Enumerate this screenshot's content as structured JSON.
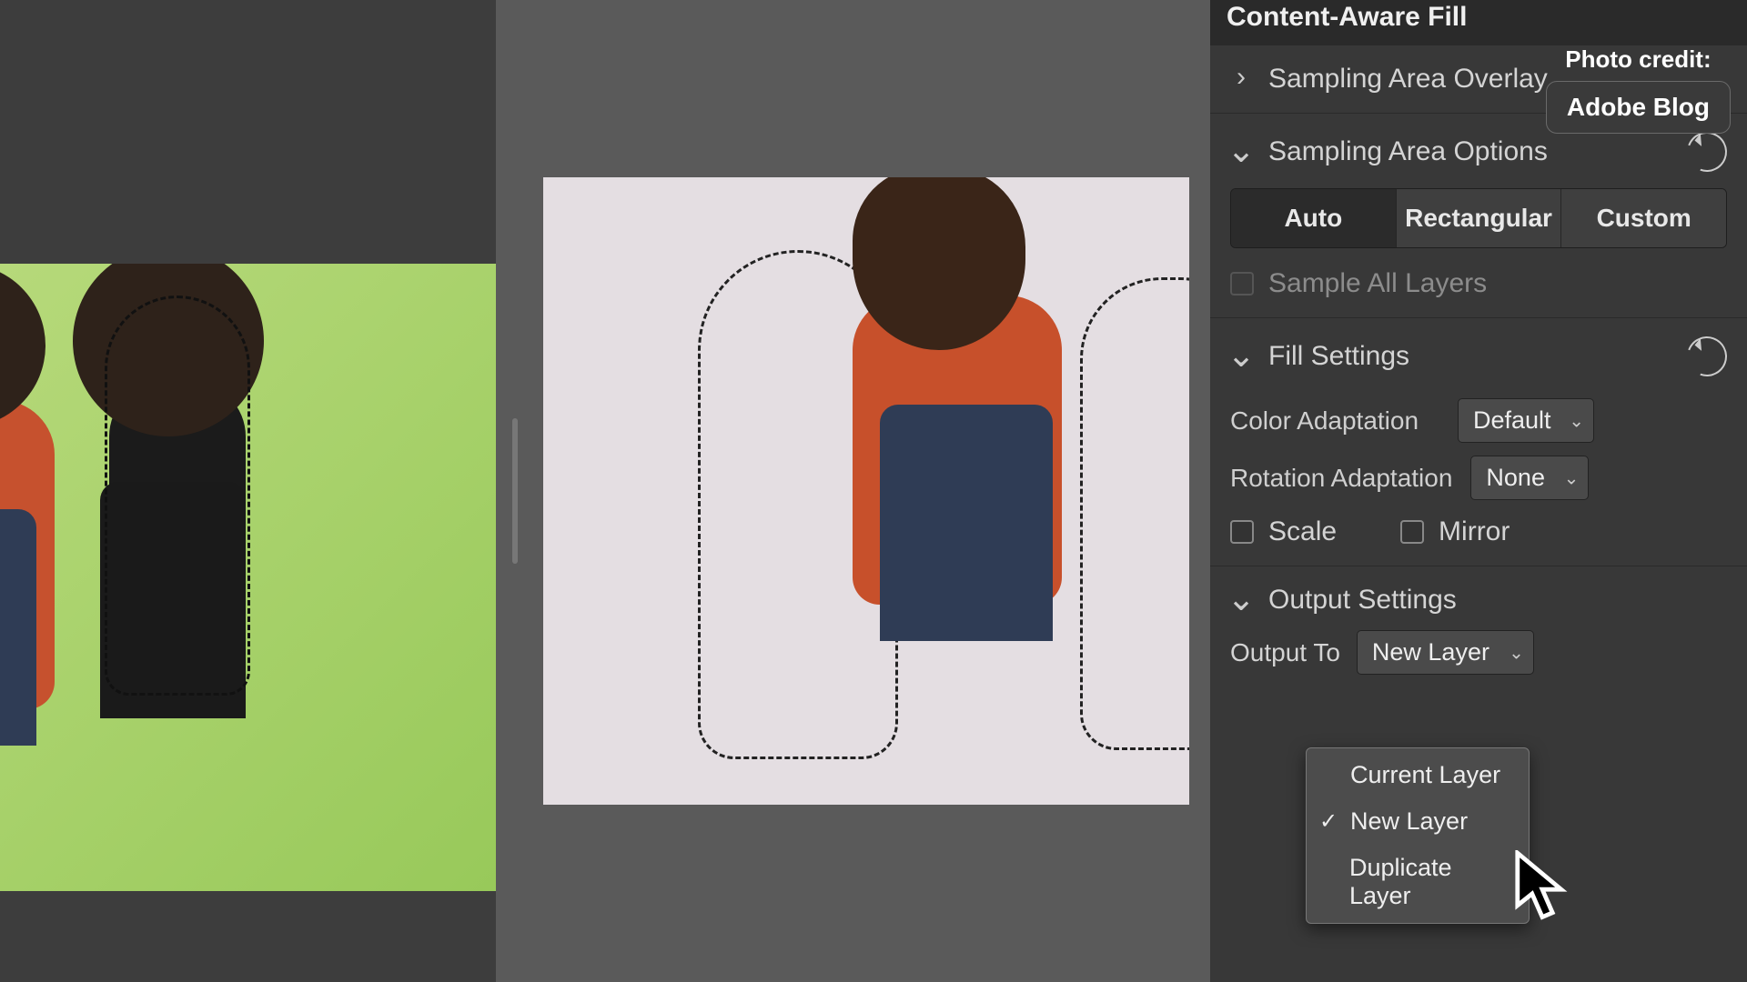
{
  "credit": {
    "label": "Photo credit:",
    "source": "Adobe Blog"
  },
  "panel": {
    "title": "Content-Aware Fill",
    "sampling_overlay": {
      "label": "Sampling Area Overlay"
    },
    "sampling_options": {
      "label": "Sampling Area Options",
      "segments": {
        "auto": "Auto",
        "rectangular": "Rectangular",
        "custom": "Custom"
      },
      "active": "Auto",
      "sample_all_layers": "Sample All Layers"
    },
    "fill_settings": {
      "label": "Fill Settings",
      "color_adaptation": {
        "label": "Color Adaptation",
        "value": "Default"
      },
      "rotation_adaptation": {
        "label": "Rotation Adaptation",
        "value": "None"
      },
      "scale": "Scale",
      "mirror": "Mirror"
    },
    "output_settings": {
      "label": "Output Settings",
      "output_to": {
        "label": "Output To",
        "value": "New Layer"
      },
      "options": {
        "current": "Current Layer",
        "new": "New Layer",
        "duplicate": "Duplicate Layer"
      },
      "selected": "New Layer"
    }
  }
}
